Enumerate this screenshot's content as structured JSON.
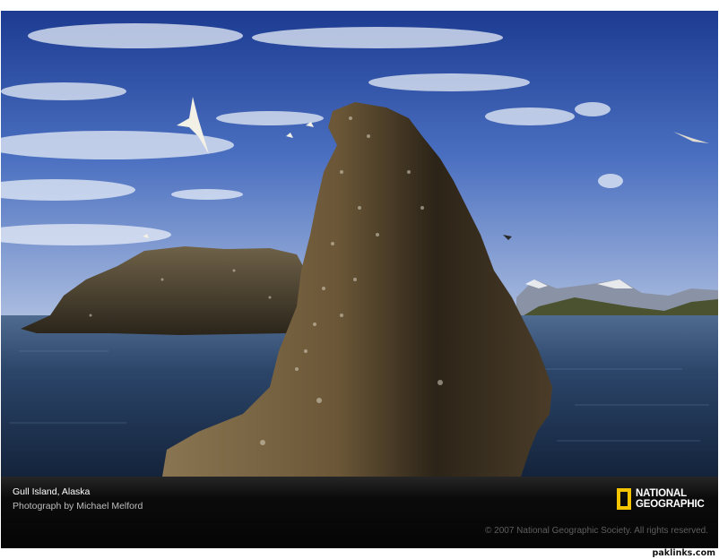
{
  "caption": {
    "title": "Gull Island, Alaska",
    "credit": "Photograph by Michael Melford",
    "copyright": "© 2007 National Geographic Society. All rights reserved."
  },
  "logo": {
    "line1": "NATIONAL",
    "line2": "GEOGRAPHIC",
    "border_color": "#f5c400"
  },
  "watermark": "paklinks.com",
  "colors": {
    "sky_top": "#1f3f96",
    "sky_bottom": "#b9c8e4",
    "water": "#1e3556",
    "rock": "#6e5a3a"
  }
}
